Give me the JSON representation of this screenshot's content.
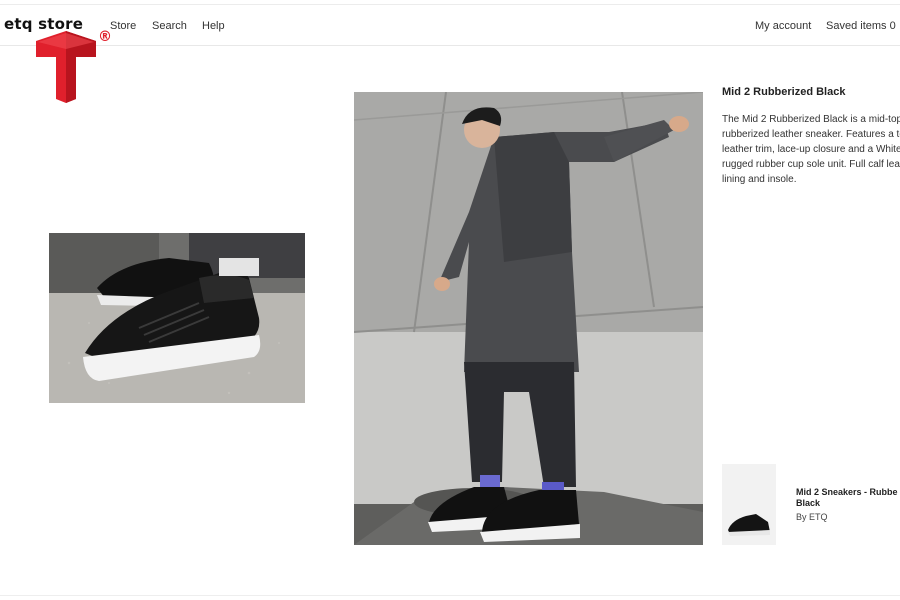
{
  "header": {
    "brand": "etq store",
    "nav": [
      {
        "label": "Store"
      },
      {
        "label": "Search"
      },
      {
        "label": "Help"
      }
    ],
    "account": "My account",
    "saved": "Saved items 0"
  },
  "watermark": {
    "registered_mark": "®"
  },
  "product": {
    "title": "Mid 2 Rubberized Black",
    "description_lines": [
      "The Mid 2 Rubberized Black is a mid-top",
      "rubberized leather sneaker. Features a to",
      "leather trim, lace-up closure and a White",
      "rugged rubber cup sole unit. Full calf lea",
      "lining and insole."
    ]
  },
  "related": {
    "name_lines": [
      "Mid 2 Sneakers - Rubbe",
      "Black"
    ],
    "brand": "By ETQ"
  },
  "colors": {
    "logo_red": "#e0202c",
    "text": "#222222",
    "wall": "#b6b6b4",
    "coat": "#4a4b4e"
  },
  "images": {
    "left": "sneaker-closeup-photo",
    "main": "model-lookbook-photo",
    "thumb": "sneaker-thumbnail"
  }
}
